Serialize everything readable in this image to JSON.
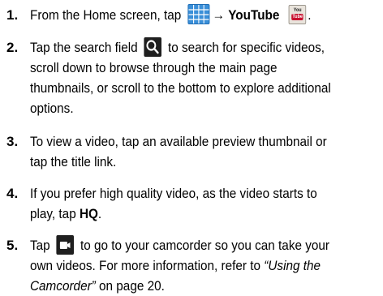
{
  "steps": [
    {
      "number": "1.",
      "lines": [
        {
          "before": "From the Home screen, tap",
          "arrow": "→",
          "bold": "YouTube",
          "after": "."
        }
      ],
      "icons": {
        "apps_grid": "apps-grid-icon",
        "youtube": "youtube-icon"
      },
      "youtube_icon_text": {
        "top": "You",
        "bottom": "Tube"
      }
    },
    {
      "number": "2.",
      "lines": [
        {
          "before": "Tap the search field",
          "after": "to search for specific videos,"
        },
        {
          "text": "scroll down to browse through the main page"
        },
        {
          "text": "thumbnails, or scroll to the bottom to explore additional"
        },
        {
          "text": "options."
        }
      ],
      "icons": {
        "search": "search-icon"
      }
    },
    {
      "number": "3.",
      "lines": [
        {
          "text": "To view a video, tap an available preview thumbnail or"
        },
        {
          "text": "tap the title link."
        }
      ]
    },
    {
      "number": "4.",
      "lines": [
        {
          "text": "If you prefer high quality video, as the video starts to"
        },
        {
          "before": "play, tap",
          "bold": "HQ",
          "after": "."
        }
      ]
    },
    {
      "number": "5.",
      "lines": [
        {
          "before": "Tap",
          "after": "to go to your camcorder so you can take your"
        },
        {
          "text": "own videos. For more information, refer to",
          "italic": "“Using the"
        },
        {
          "italic": "Camcorder”",
          "text": " on page 20."
        }
      ],
      "icons": {
        "camcorder": "camcorder-icon"
      }
    }
  ],
  "colors": {
    "apps_grid_icon": "#3a8fd8",
    "youtube_red": "#c8102e",
    "dark_icon": "#1f1f1f"
  }
}
